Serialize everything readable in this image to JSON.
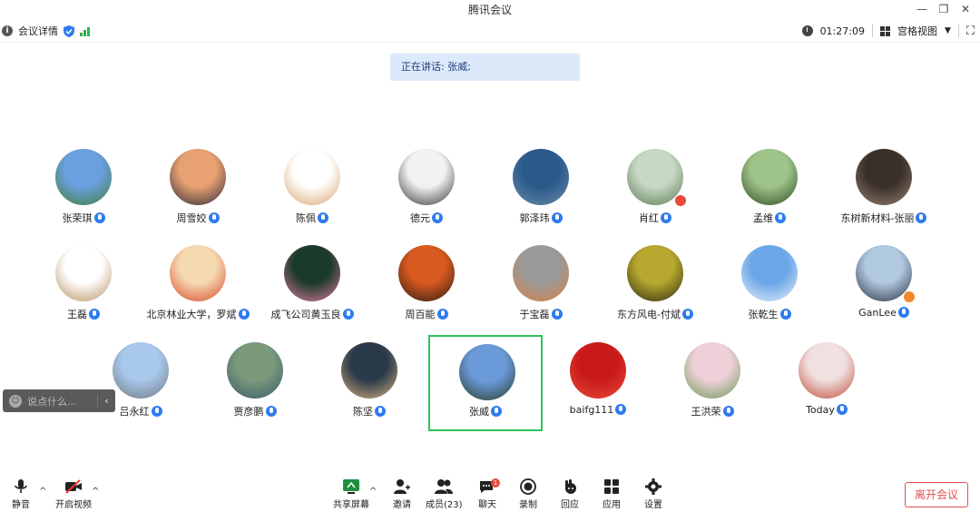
{
  "window": {
    "title": "腾讯会议",
    "controls": [
      "minimize",
      "restore",
      "close"
    ]
  },
  "infobar": {
    "details_label": "会议详情",
    "timer": "01:27:09",
    "view_label": "宫格视图"
  },
  "speaking": {
    "text": "正在讲话: 张威;"
  },
  "participants": [
    {
      "name": "张荣琪",
      "colors": [
        "#6aa0e0",
        "#3f7d35"
      ]
    },
    {
      "name": "周雪姣",
      "colors": [
        "#e8a170",
        "#2a2a3a"
      ]
    },
    {
      "name": "陈佩",
      "colors": [
        "#ffffff",
        "#d9a36c"
      ]
    },
    {
      "name": "德元",
      "colors": [
        "#f2f2f2",
        "#333333"
      ]
    },
    {
      "name": "郭泽玮",
      "colors": [
        "#2a5a8a",
        "#6b8aa8"
      ]
    },
    {
      "name": "肖红",
      "colors": [
        "#c7d8c4",
        "#5a7a52"
      ],
      "badge": "#e84a3b"
    },
    {
      "name": "孟维",
      "colors": [
        "#9fc48a",
        "#2e4a22"
      ]
    },
    {
      "name": "东树新材料-张丽",
      "colors": [
        "#3a302a",
        "#9a8070"
      ]
    },
    {
      "name": "王磊",
      "colors": [
        "#ffffff",
        "#b89060"
      ]
    },
    {
      "name": "北京林业大学，罗斌",
      "colors": [
        "#f5d9b0",
        "#d9482a"
      ]
    },
    {
      "name": "成飞公司黄玉良",
      "colors": [
        "#1a3a2a",
        "#e07aa0"
      ]
    },
    {
      "name": "周百能",
      "colors": [
        "#d85a20",
        "#2a1a10"
      ]
    },
    {
      "name": "于宝磊",
      "colors": [
        "#9a9a9a",
        "#d88040"
      ]
    },
    {
      "name": "东方风电-付斌",
      "colors": [
        "#b8a830",
        "#2a2a10"
      ]
    },
    {
      "name": "张乾生",
      "colors": [
        "#6aa6e8",
        "#e8f0fa"
      ]
    },
    {
      "name": "GanLee",
      "colors": [
        "#b0c8e0",
        "#2a3040"
      ],
      "badge": "#f08a2a"
    },
    {
      "name": "吕永红",
      "colors": [
        "#a8c8ec",
        "#707880"
      ]
    },
    {
      "name": "贾彦鹏",
      "colors": [
        "#7a9a7a",
        "#3a5a70"
      ]
    },
    {
      "name": "陈坚",
      "colors": [
        "#2a3a4a",
        "#d8b080"
      ]
    },
    {
      "name": "张威",
      "colors": [
        "#6a9ad8",
        "#2a3a2a"
      ],
      "active": true
    },
    {
      "name": "baifg111",
      "colors": [
        "#c81a1a",
        "#e84a3a"
      ]
    },
    {
      "name": "王洪荣",
      "colors": [
        "#f0d0d8",
        "#6a9a5a"
      ]
    },
    {
      "name": "Today",
      "colors": [
        "#f0e0e0",
        "#c04a3a"
      ]
    }
  ],
  "chat_popup": {
    "placeholder": "说点什么...",
    "collapse": "‹"
  },
  "toolbar": {
    "mute": "静音",
    "video": "开启视频",
    "share": "共享屏幕",
    "invite": "邀请",
    "members": "成员(23)",
    "chat": "聊天",
    "chat_badge": "1",
    "record": "录制",
    "react": "回应",
    "apps": "应用",
    "settings": "设置",
    "leave": "离开会议"
  },
  "colors": {
    "accent_blue": "#2e7bf0",
    "active_border": "#2fc35a",
    "leave_red": "#e35050",
    "speaker_bg": "#dce9fb"
  }
}
